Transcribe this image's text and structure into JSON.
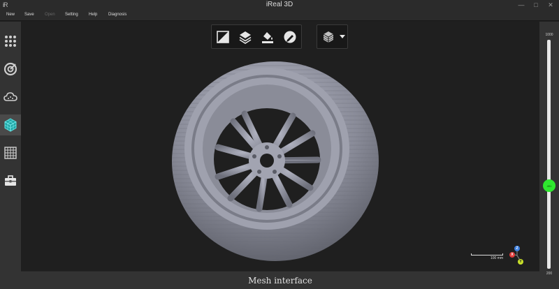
{
  "window": {
    "logo": "iR",
    "title": "iReal 3D",
    "minimize": "—",
    "maximize": "□",
    "close": "✕"
  },
  "menu": [
    {
      "label": "New",
      "enabled": true
    },
    {
      "label": "Save",
      "enabled": true
    },
    {
      "label": "Open",
      "enabled": false
    },
    {
      "label": "Setting",
      "enabled": true
    },
    {
      "label": "Help",
      "enabled": true
    },
    {
      "label": "Diagnosis",
      "enabled": true
    }
  ],
  "sidebar": [
    {
      "icon": "grid-dots-icon",
      "active": false
    },
    {
      "icon": "scan-target-icon",
      "active": false
    },
    {
      "icon": "cloud-icon",
      "active": false
    },
    {
      "icon": "mesh-cube-icon",
      "active": true
    },
    {
      "icon": "grid-table-icon",
      "active": false
    },
    {
      "icon": "toolbox-icon",
      "active": false
    }
  ],
  "toolbar": [
    {
      "icon": "crop-icon"
    },
    {
      "icon": "layers-icon"
    },
    {
      "icon": "fill-bucket-icon"
    },
    {
      "icon": "sphere-edit-icon"
    }
  ],
  "view_menu": {
    "icon": "cube-view-icon"
  },
  "status": {
    "text": "Mesh interface"
  },
  "slider": {
    "max": "1000",
    "min": "200",
    "thumb_label": "491",
    "value": 491
  },
  "scale": {
    "label": "100  mm"
  },
  "axes": {
    "z": "Z",
    "x": "X",
    "y": "Y"
  },
  "colors": {
    "accent": "#2ee72e",
    "background": "#1f1f1f",
    "panel": "#333333"
  }
}
